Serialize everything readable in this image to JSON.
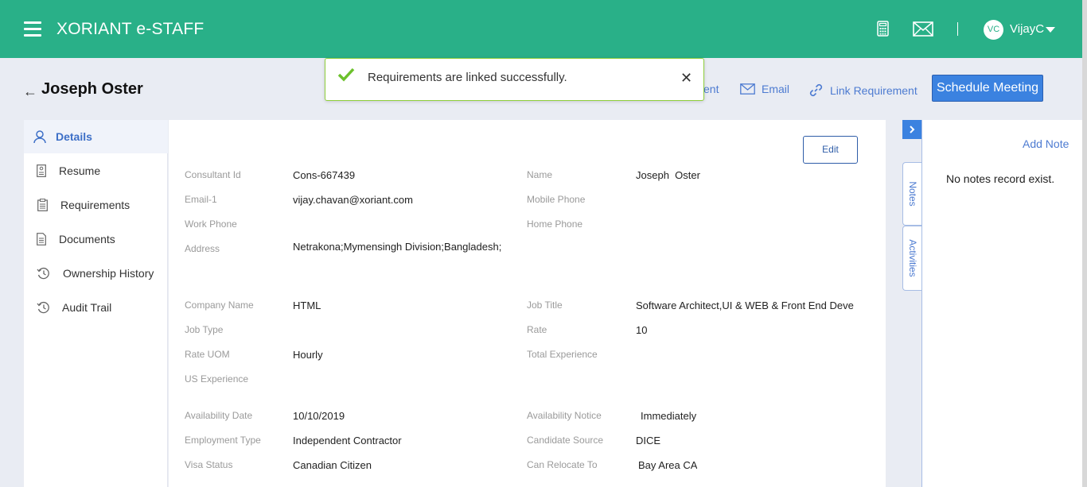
{
  "header": {
    "brand": "XORIANT e-STAFF",
    "user_initials": "VC",
    "username": "VijayC",
    "icons": [
      "calculator-icon",
      "mail-icon"
    ]
  },
  "title_row": {
    "back_icon": "arrow-left-icon",
    "title": "Joseph Oster",
    "actions": {
      "partial_label": "ent",
      "email": "Email",
      "link_requirement": "Link Requirement",
      "schedule_meeting": "Schedule Meeting"
    }
  },
  "toast": {
    "message": "Requirements are linked successfully.",
    "close": "✕",
    "color": "#8fcf3c"
  },
  "sidebar": {
    "items": [
      {
        "label": "Details",
        "icon": "user-icon",
        "active": true
      },
      {
        "label": "Resume",
        "icon": "resume-icon"
      },
      {
        "label": "Requirements",
        "icon": "clipboard-icon"
      },
      {
        "label": "Documents",
        "icon": "document-icon"
      },
      {
        "label": "Ownership History",
        "icon": "history-icon"
      },
      {
        "label": "Audit Trail",
        "icon": "history-icon"
      }
    ]
  },
  "details": {
    "edit_label": "Edit",
    "fields": {
      "consultant_id": {
        "label": "Consultant Id",
        "value": "Cons-667439"
      },
      "name": {
        "label": "Name",
        "value": "Joseph  Oster"
      },
      "email1": {
        "label": "Email-1",
        "value": "vijay.chavan@xoriant.com"
      },
      "mobile_phone": {
        "label": "Mobile Phone",
        "value": ""
      },
      "work_phone": {
        "label": "Work Phone",
        "value": ""
      },
      "home_phone": {
        "label": "Home Phone",
        "value": ""
      },
      "address": {
        "label": "Address",
        "value": "Netrakona;Mymensingh Division;Bangladesh;"
      },
      "company_name": {
        "label": "Company Name",
        "value": "HTML"
      },
      "job_title": {
        "label": "Job Title",
        "value": "Software Architect,UI & WEB & Front End Devel"
      },
      "job_type": {
        "label": "Job Type",
        "value": ""
      },
      "rate": {
        "label": "Rate",
        "value": "10"
      },
      "rate_uom": {
        "label": "Rate UOM",
        "value": "Hourly"
      },
      "total_experience": {
        "label": "Total Experience",
        "value": ""
      },
      "us_experience": {
        "label": "US Experience",
        "value": ""
      },
      "availability_date": {
        "label": "Availability Date",
        "value": "10/10/2019"
      },
      "availability_notice": {
        "label": "Availability Notice",
        "value": "Immediately"
      },
      "employment_type": {
        "label": "Employment Type",
        "value": "Independent Contractor"
      },
      "candidate_source": {
        "label": "Candidate Source",
        "value": "DICE"
      },
      "visa_status": {
        "label": "Visa Status",
        "value": "Canadian Citizen"
      },
      "can_relocate_to": {
        "label": "Can Relocate To",
        "value": "Bay Area CA"
      }
    }
  },
  "right_panel": {
    "tabs": [
      "Notes",
      "Activities"
    ],
    "add_note": "Add Note",
    "empty_message": "No notes record exist."
  },
  "colors": {
    "header": "#29b088",
    "accent": "#3b82e0",
    "link": "#4d7bd1"
  }
}
